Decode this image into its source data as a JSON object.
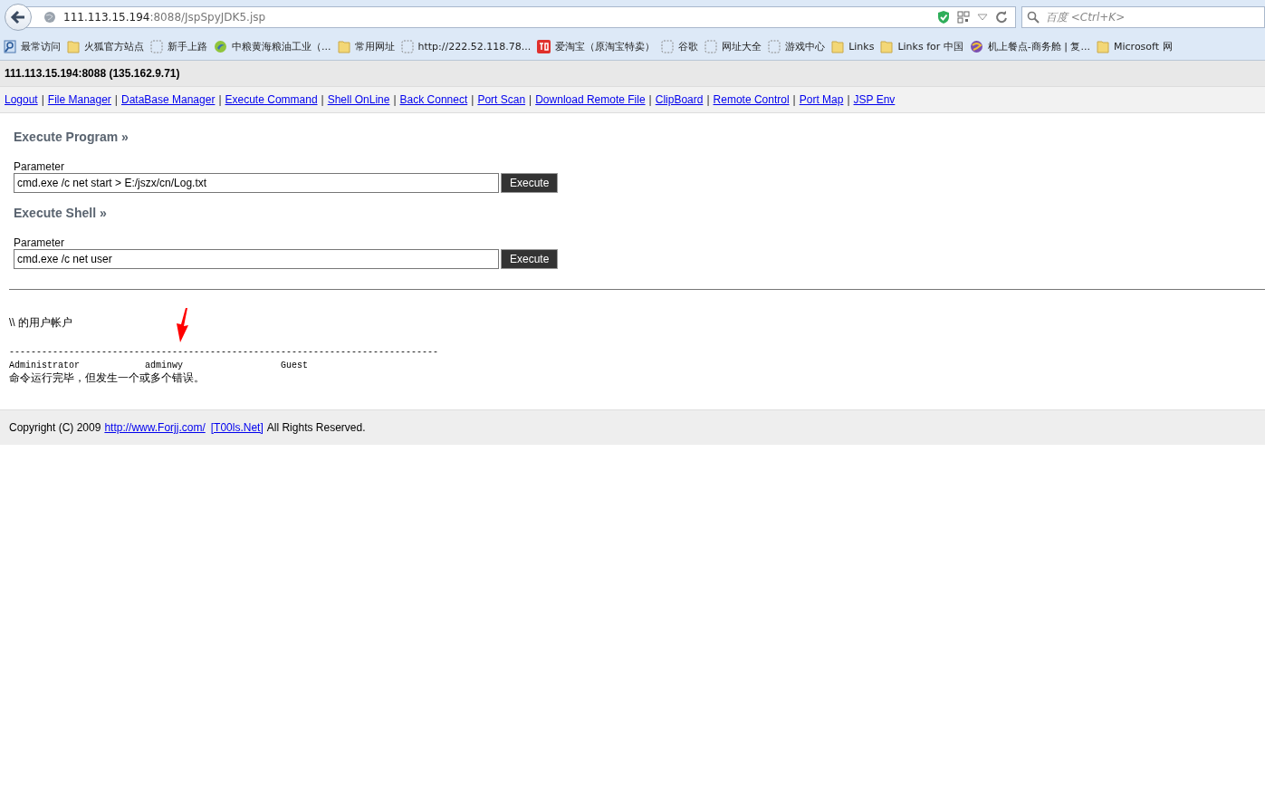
{
  "browser": {
    "url_host": "111.113.15.194",
    "url_rest": ":8088/JspSpyJDK5.jsp",
    "search": {
      "placeholder": "百度 <Ctrl+K>"
    },
    "bookmarks": [
      {
        "kind": "history",
        "label": "最常访问"
      },
      {
        "kind": "folder",
        "label": "火狐官方站点"
      },
      {
        "kind": "blank",
        "label": "新手上路"
      },
      {
        "kind": "swirl",
        "label": "中粮黄海粮油工业（..."
      },
      {
        "kind": "folder",
        "label": "常用网址"
      },
      {
        "kind": "blank",
        "label": "http://222.52.118.78..."
      },
      {
        "kind": "tao",
        "label": "爱淘宝（原淘宝特卖）"
      },
      {
        "kind": "blank",
        "label": "谷歌"
      },
      {
        "kind": "blank",
        "label": "网址大全"
      },
      {
        "kind": "blank",
        "label": "游戏中心"
      },
      {
        "kind": "folder",
        "label": "Links"
      },
      {
        "kind": "folder",
        "label": "Links for 中国"
      },
      {
        "kind": "globe",
        "label": "机上餐点-商务舱 | 复..."
      },
      {
        "kind": "folder",
        "label": "Microsoft 网"
      }
    ]
  },
  "page": {
    "host_title": "111.113.15.194:8088 (135.162.9.71)",
    "nav_separator": "|",
    "nav_links": [
      "Logout",
      "File Manager",
      "DataBase Manager",
      "Execute Command",
      "Shell OnLine",
      "Back Connect",
      "Port Scan",
      "Download Remote File",
      "ClipBoard",
      "Remote Control",
      "Port Map",
      "JSP Env"
    ],
    "sections": [
      {
        "title": "Execute Program »",
        "field_label": "Parameter",
        "value": "cmd.exe /c net start > E:/jszx/cn/Log.txt",
        "button": "Execute"
      },
      {
        "title": "Execute Shell »",
        "field_label": "Parameter",
        "value": "cmd.exe /c net user",
        "button": "Execute"
      }
    ],
    "output": {
      "heading": "\\\\ 的用户帐户",
      "separator": "-------------------------------------------------------------------------------",
      "accounts": [
        "Administrator",
        "adminwy",
        "Guest"
      ],
      "message": "命令运行完毕，但发生一个或多个错误。"
    },
    "footer": {
      "before": "Copyright (C) 2009",
      "link_1": "http://www.Forjj.com/",
      "link_2": "[T00ls.Net]",
      "after": "All Rights Reserved."
    }
  }
}
